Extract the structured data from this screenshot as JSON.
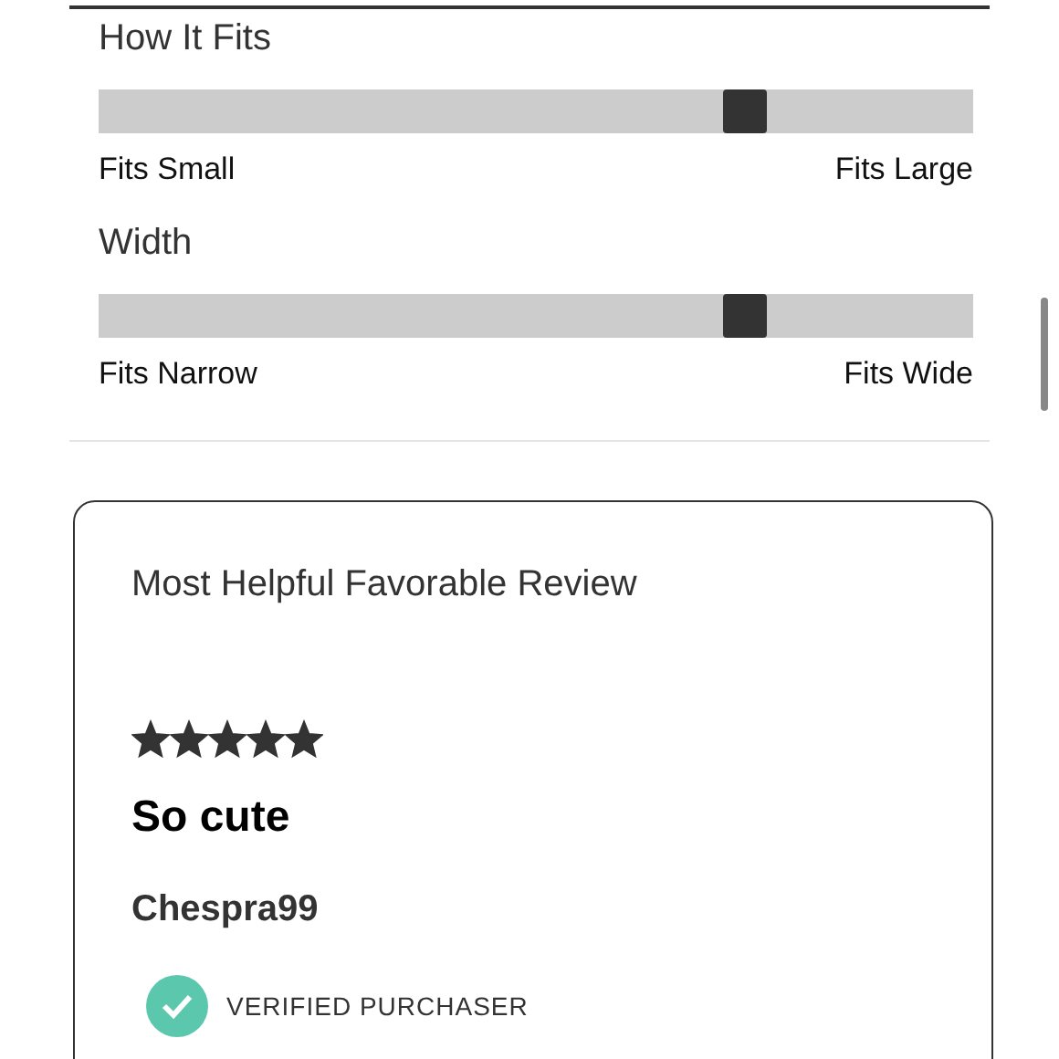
{
  "fit_sliders": [
    {
      "title": "How It Fits",
      "level": 0.74,
      "min_label": "Fits Small",
      "max_label": "Fits Large"
    },
    {
      "title": "Width",
      "level": 0.74,
      "min_label": "Fits Narrow",
      "max_label": "Fits Wide"
    }
  ],
  "review_card": {
    "heading": "Most Helpful Favorable Review",
    "stars": 5,
    "title": "So cute",
    "author": "Chespra99",
    "verified": true,
    "verified_label": "VERIFIED PURCHASER"
  }
}
